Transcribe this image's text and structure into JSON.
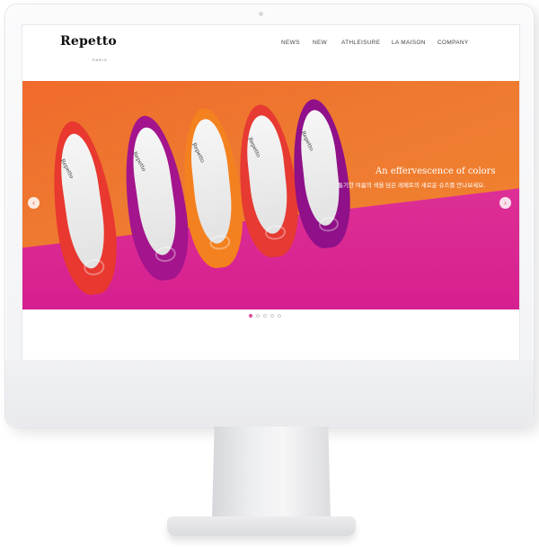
{
  "brand": {
    "logo": "Repetto",
    "logo_sub": "PARIS"
  },
  "nav": {
    "items": [
      "NEWS",
      "NEW",
      "ATHLEISURE",
      "LA MAISON",
      "COMPANY"
    ]
  },
  "hero": {
    "title": "An effervescence of colors",
    "subtitle": "통기한 여름의 색을 담은 레페토의 새로운 슈즈를 만나보세요.",
    "shoe_brand": "Repetto",
    "prev_label": "‹",
    "next_label": "›",
    "slide_count": 5,
    "active_slide": 1,
    "colors": {
      "wall": "#f07a2e",
      "floor": "#d8238f",
      "shoes": [
        "#ea3b32",
        "#a4138e",
        "#f5801e",
        "#e83a33",
        "#8e1087"
      ]
    }
  }
}
